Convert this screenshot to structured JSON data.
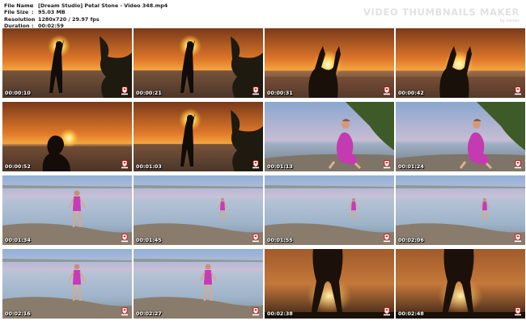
{
  "file_info": [
    {
      "label": "File Name",
      "value": "[Dream Studio] Petal Stone - Video 348.mp4"
    },
    {
      "label": "File Size",
      "value": "95.03 MB"
    },
    {
      "label": "Resolution",
      "value": "1280x720 / 29.97 fps"
    },
    {
      "label": "Duration",
      "value": "00:02:59"
    }
  ],
  "separator": ":",
  "brand": {
    "title": "VIDEO THUMBNAILS MAKER",
    "subtitle": "by Deloss"
  },
  "thumbnails": [
    {
      "time": "00:00:10",
      "scene": "sunset-arms-up-wide"
    },
    {
      "time": "00:00:21",
      "scene": "sunset-arms-up-wide"
    },
    {
      "time": "00:00:31",
      "scene": "sunset-sun-hands-close"
    },
    {
      "time": "00:00:42",
      "scene": "sunset-sun-hands-close"
    },
    {
      "time": "00:00:52",
      "scene": "sunset-head-silhouette"
    },
    {
      "time": "00:01:03",
      "scene": "sunset-arms-up-wide"
    },
    {
      "time": "00:01:13",
      "scene": "beach-sitting"
    },
    {
      "time": "00:01:24",
      "scene": "beach-sitting"
    },
    {
      "time": "00:01:34",
      "scene": "shore-standing"
    },
    {
      "time": "00:01:45",
      "scene": "shore-standing-far"
    },
    {
      "time": "00:01:55",
      "scene": "shore-standing-far"
    },
    {
      "time": "00:02:06",
      "scene": "shore-standing-far"
    },
    {
      "time": "00:02:16",
      "scene": "shore-standing"
    },
    {
      "time": "00:02:27",
      "scene": "shore-standing"
    },
    {
      "time": "00:02:38",
      "scene": "legs-sunset"
    },
    {
      "time": "00:02:48",
      "scene": "legs-sunset"
    }
  ]
}
